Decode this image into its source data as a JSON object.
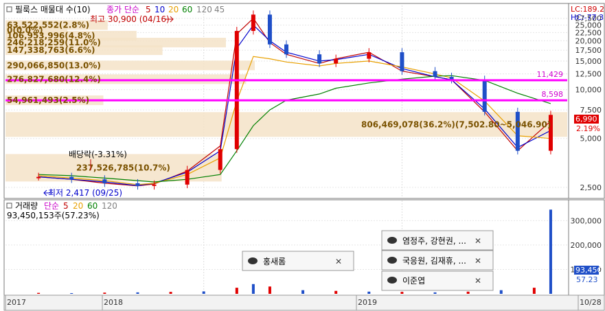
{
  "price_panel": {
    "title": "필룩스 매물대 수(10)",
    "ma_label": "종가 단순",
    "ma_periods": [
      "5",
      "10",
      "20",
      "60",
      "120",
      "45"
    ],
    "ma_colors": [
      "#c00000",
      "#0000cc",
      "#e8a000",
      "#008000",
      "#808080",
      "#808080"
    ],
    "corner_lc": "LC:189.2",
    "corner_hc": "HC:-77.3",
    "high_marker": "최고 30,900 (04/16)",
    "low_marker": "최저 2,417 (09/25)",
    "dividend_label": "배당락(-3.31%)",
    "current_price": "6,990",
    "current_change": "2.19%"
  },
  "volume_panel": {
    "title": "거래량",
    "ma_label": "단순",
    "ma_periods": [
      "5",
      "20",
      "60",
      "120"
    ],
    "summary": "93,450,153주(57.23%)",
    "current_volume": "93,45C",
    "current_pct": "57.23"
  },
  "news_popups": [
    {
      "text": "염정주, 강현권, ...",
      "close": "✕"
    },
    {
      "text": "국응원, 김재휴, ...",
      "close": "✕"
    },
    {
      "text": "이준엽",
      "close": "✕"
    },
    {
      "text": "홍새롬",
      "close": "✕"
    }
  ],
  "x_axis": [
    "2017",
    "2018",
    "2019",
    "10/28"
  ],
  "chart_data": [
    {
      "type": "candlestick",
      "title": "필룩스 매물대 수(10)",
      "y_scale": "log",
      "ylim": [
        2200,
        33000
      ],
      "y_ticks": [
        "27,500",
        "25,000",
        "22,500",
        "20,000",
        "17,500",
        "15,000",
        "12,500",
        "10,000",
        "7,500",
        "5,000",
        "2,500"
      ],
      "series": [
        {
          "name": "종가",
          "x": [
            "2017-03",
            "2017-05",
            "2017-07",
            "2017-09",
            "2017-10",
            "2017-12",
            "2018-02",
            "2018-03",
            "2018-04",
            "2018-05",
            "2018-06",
            "2018-08",
            "2018-09",
            "2018-11",
            "2019-01",
            "2019-03",
            "2019-04",
            "2019-06",
            "2019-08",
            "2019-10"
          ],
          "values": [
            2900,
            2800,
            2650,
            2550,
            2600,
            3200,
            4300,
            23000,
            29000,
            19000,
            16500,
            14500,
            15500,
            17000,
            13000,
            12000,
            11500,
            7300,
            4200,
            6990
          ]
        },
        {
          "name": "5",
          "values": [
            2900,
            2800,
            2650,
            2550,
            2620,
            3150,
            4500,
            22000,
            27500,
            19500,
            16500,
            14500,
            15500,
            17000,
            13000,
            12000,
            11500,
            7300,
            4200,
            6400
          ]
        },
        {
          "name": "10",
          "values": [
            2900,
            2800,
            2700,
            2560,
            2650,
            3100,
            4200,
            18000,
            25000,
            20000,
            17000,
            15000,
            15300,
            16500,
            13500,
            12000,
            11500,
            7600,
            4400,
            5600
          ]
        },
        {
          "name": "20",
          "values": [
            2950,
            2850,
            2750,
            2600,
            2650,
            3000,
            3800,
            8500,
            16000,
            15500,
            14800,
            14000,
            14500,
            15000,
            13800,
            12500,
            11800,
            8500,
            5200,
            5000
          ]
        },
        {
          "name": "60",
          "values": [
            3000,
            2950,
            2850,
            2750,
            2700,
            2800,
            3000,
            4200,
            6000,
            7500,
            8600,
            9400,
            10200,
            11000,
            11600,
            12100,
            12200,
            11400,
            9500,
            8200
          ]
        }
      ],
      "price_levels": [
        {
          "label": "11,429",
          "value": 11429
        },
        {
          "label": "8,598",
          "value": 8598
        }
      ],
      "volume_profile": [
        {
          "label": "63,522,552(2.8%)",
          "price": 25000
        },
        {
          "label": "0(0.0%)",
          "price": 23200
        },
        {
          "label": "106,953,996(4.8%)",
          "price": 21500
        },
        {
          "label": "246,218,259(11.0%)",
          "price": 19500
        },
        {
          "label": "147,338,763(6.6%)",
          "price": 17500
        },
        {
          "label": "290,066,850(13.0%)",
          "price": 14100
        },
        {
          "label": "276,827,680(12.4%)",
          "price": 11600
        },
        {
          "label": "54,961,493(2.5%)",
          "price": 8600
        },
        {
          "label": "806,469,078(36.2%)(7,502.80~5,046.90)",
          "price": 6100
        },
        {
          "label": "237,526,785(10.7%)",
          "price": 3300
        }
      ]
    },
    {
      "type": "bar",
      "title": "거래량",
      "y_ticks": [
        "300,000",
        "200,000",
        "100,000"
      ],
      "ylim": [
        0,
        360000
      ],
      "categories": [
        "2017-03",
        "2017-05",
        "2017-07",
        "2017-09",
        "2017-11",
        "2018-01",
        "2018-03",
        "2018-04",
        "2018-05",
        "2018-07",
        "2018-09",
        "2018-11",
        "2019-01",
        "2019-03",
        "2019-05",
        "2019-07",
        "2019-09",
        "2019-10"
      ],
      "values": [
        4000,
        3000,
        5000,
        6000,
        8000,
        10000,
        25000,
        40000,
        30000,
        15000,
        12000,
        9000,
        8000,
        6000,
        9000,
        15000,
        25000,
        345000
      ]
    }
  ]
}
